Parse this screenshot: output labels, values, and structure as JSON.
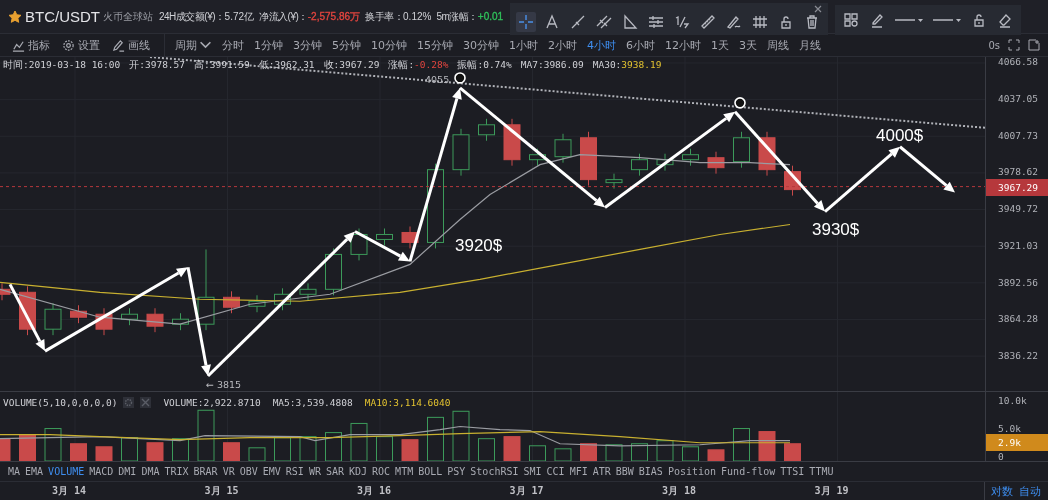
{
  "header": {
    "favorite": true,
    "title": "BTC/USDT",
    "exchange": "火币全球站",
    "stats": [
      {
        "label": "24H成交额(¥)：",
        "value": "5.72亿"
      },
      {
        "label": "净流入(¥)：",
        "value": "-2,575.86万",
        "color": "#e0443e"
      },
      {
        "label": "换手率：",
        "value": "0.12%"
      },
      {
        "label": "5m涨幅：",
        "value": "+0.01",
        "color": "#2fbf5a"
      }
    ]
  },
  "drawing_toolbar": {
    "groups": [
      [
        {
          "kind": "crosshair",
          "selected": true
        },
        {
          "kind": "text",
          "selected": false
        },
        {
          "kind": "segment",
          "selected": false
        },
        {
          "kind": "parallel",
          "selected": false
        },
        {
          "kind": "triangle",
          "selected": false
        },
        {
          "kind": "fib",
          "selected": false
        },
        {
          "kind": "fraction",
          "selected": false
        },
        {
          "kind": "ruler",
          "selected": false
        },
        {
          "kind": "brush",
          "selected": false
        },
        {
          "kind": "grid",
          "selected": false
        },
        {
          "kind": "lock",
          "selected": false
        },
        {
          "kind": "trash",
          "selected": false
        }
      ],
      [
        {
          "kind": "shapes",
          "selected": false
        },
        {
          "kind": "pencil",
          "selected": false
        },
        {
          "kind": "linestyle",
          "selected": false
        },
        {
          "kind": "linestyle",
          "selected": false
        },
        {
          "kind": "lock",
          "selected": false
        },
        {
          "kind": "eraser",
          "selected": false
        }
      ]
    ]
  },
  "toolbar": {
    "tools": [
      {
        "kind": "indicator",
        "label": "指标"
      },
      {
        "kind": "settings",
        "label": "设置"
      },
      {
        "kind": "draw",
        "label": "画线"
      }
    ],
    "period_label": "周期",
    "periods": [
      {
        "label": "分时",
        "selected": false
      },
      {
        "label": "1分钟",
        "selected": false
      },
      {
        "label": "3分钟",
        "selected": false
      },
      {
        "label": "5分钟",
        "selected": false
      },
      {
        "label": "10分钟",
        "selected": false
      },
      {
        "label": "15分钟",
        "selected": false
      },
      {
        "label": "30分钟",
        "selected": false
      },
      {
        "label": "1小时",
        "selected": false
      },
      {
        "label": "2小时",
        "selected": false
      },
      {
        "label": "4小时",
        "selected": true
      },
      {
        "label": "6小时",
        "selected": false
      },
      {
        "label": "12小时",
        "selected": false
      },
      {
        "label": "1天",
        "selected": false
      },
      {
        "label": "3天",
        "selected": false
      },
      {
        "label": "周线",
        "selected": false
      },
      {
        "label": "月线",
        "selected": false
      }
    ],
    "countdown": "0s"
  },
  "info": [
    {
      "label": "时间:",
      "value": "2019-03-18 16:00"
    },
    {
      "label": "开:",
      "value": "3978.57"
    },
    {
      "label": "高:",
      "value": "3991.59"
    },
    {
      "label": "低:",
      "value": "3962.31"
    },
    {
      "label": "收:",
      "value": "3967.29"
    },
    {
      "label": "涨幅:",
      "value": "-0.28%",
      "color": "#e0443e"
    },
    {
      "label": "振幅:",
      "value": "0.74%"
    },
    {
      "label": "MA7:",
      "value": "3986.09"
    },
    {
      "label": "MA30:",
      "value": "3938.19",
      "color": "#e2c230"
    }
  ],
  "chart": {
    "price_axis": [
      "4066.58",
      "4037.05",
      "4007.73",
      "3978.62",
      "3949.72",
      "3921.03",
      "3892.56",
      "3864.28",
      "3836.22"
    ],
    "last_price": "3967.29",
    "annotations": [
      {
        "kind": "label",
        "text": "4055"
      },
      {
        "kind": "label",
        "text": "← 3815"
      },
      {
        "kind": "target",
        "text": "3920$"
      },
      {
        "kind": "target",
        "text": "3930$"
      },
      {
        "kind": "target",
        "text": "4000$"
      }
    ]
  },
  "volume": {
    "legend": "VOLUME(5,10,0,0,0,0)",
    "values": [
      {
        "text": "VOLUME:2,922.8710"
      },
      {
        "text": "MA5:3,539.4808"
      },
      {
        "text": "MA10:3,114.6040",
        "color": "#e2c230"
      }
    ],
    "axis": [
      "10.0k",
      "5.0k",
      "0"
    ],
    "last": "2.9k"
  },
  "indicators": [
    {
      "label": "MA",
      "selected": false
    },
    {
      "label": "EMA",
      "selected": false
    },
    {
      "label": "VOLUME",
      "selected": true
    },
    {
      "label": "MACD",
      "selected": false
    },
    {
      "label": "DMI",
      "selected": false
    },
    {
      "label": "DMA",
      "selected": false
    },
    {
      "label": "TRIX",
      "selected": false
    },
    {
      "label": "BRAR",
      "selected": false
    },
    {
      "label": "VR",
      "selected": false
    },
    {
      "label": "OBV",
      "selected": false
    },
    {
      "label": "EMV",
      "selected": false
    },
    {
      "label": "RSI",
      "selected": false
    },
    {
      "label": "WR",
      "selected": false
    },
    {
      "label": "SAR",
      "selected": false
    },
    {
      "label": "KDJ",
      "selected": false
    },
    {
      "label": "ROC",
      "selected": false
    },
    {
      "label": "MTM",
      "selected": false
    },
    {
      "label": "BOLL",
      "selected": false
    },
    {
      "label": "PSY",
      "selected": false
    },
    {
      "label": "StochRSI",
      "selected": false
    },
    {
      "label": "SMI",
      "selected": false
    },
    {
      "label": "CCI",
      "selected": false
    },
    {
      "label": "MFI",
      "selected": false
    },
    {
      "label": "ATR",
      "selected": false
    },
    {
      "label": "BBW",
      "selected": false
    },
    {
      "label": "BIAS",
      "selected": false
    },
    {
      "label": "Position",
      "selected": false
    },
    {
      "label": "Fund-flow",
      "selected": false
    },
    {
      "label": "TTSI",
      "selected": false
    },
    {
      "label": "TTMU",
      "selected": false
    }
  ],
  "dates": [
    "3月 14",
    "3月 15",
    "3月 16",
    "3月 17",
    "3月 18",
    "3月 19"
  ],
  "axis_modes": [
    "对数",
    "自动"
  ]
}
